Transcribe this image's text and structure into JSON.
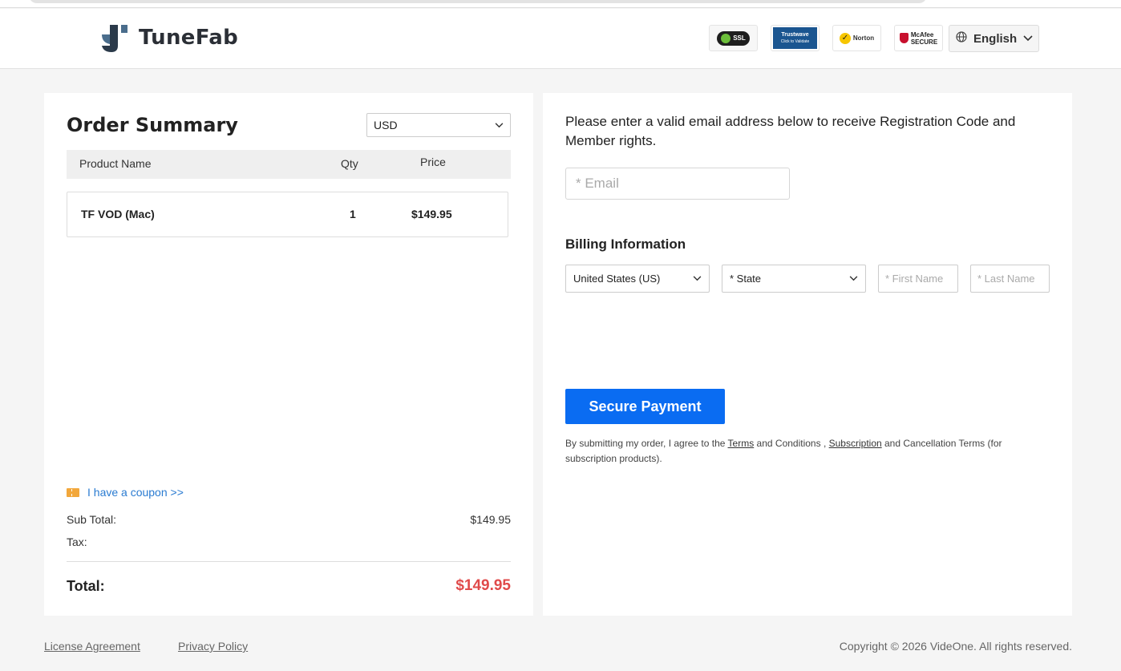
{
  "brand": {
    "name": "TuneFab"
  },
  "badges": {
    "ssl": "SSL",
    "trustwave": "Trustwave",
    "trustwave_sub": "Click to Validate",
    "norton": "Norton",
    "mcafee_1": "McAfee",
    "mcafee_2": "SECURE"
  },
  "language": {
    "selected": "English"
  },
  "order": {
    "title": "Order Summary",
    "currency": "USD",
    "columns": {
      "product": "Product Name",
      "qty": "Qty",
      "price": "Price"
    },
    "items": [
      {
        "name": "TF VOD (Mac)",
        "qty": "1",
        "price": "$149.95"
      }
    ],
    "coupon_link": "I have a coupon >>",
    "subtotal_label": "Sub Total:",
    "subtotal_value": "$149.95",
    "tax_label": "Tax:",
    "total_label": "Total:",
    "total_value": "$149.95"
  },
  "form": {
    "instruction": "Please enter a valid email address below to receive Registration Code and Member rights.",
    "email_placeholder": "* Email",
    "billing_title": "Billing Information",
    "country": "United States (US)",
    "state": "* State",
    "first_name_placeholder": "* First Name",
    "last_name_placeholder": "* Last Name",
    "pay_button": "Secure Payment",
    "terms": {
      "prefix": "By submitting my order, I agree to the ",
      "terms_link": "Terms",
      "middle": " and Conditions , ",
      "subscription_link": "Subscription",
      "suffix": " and Cancellation Terms (for subscription products)."
    }
  },
  "footer": {
    "license": "License Agreement",
    "privacy": "Privacy Policy",
    "copyright": "Copyright © 2026 VideOne. All rights reserved."
  },
  "colors": {
    "accent": "#0a6cf2",
    "total": "#e04a4a",
    "link": "#2a7bd1"
  }
}
